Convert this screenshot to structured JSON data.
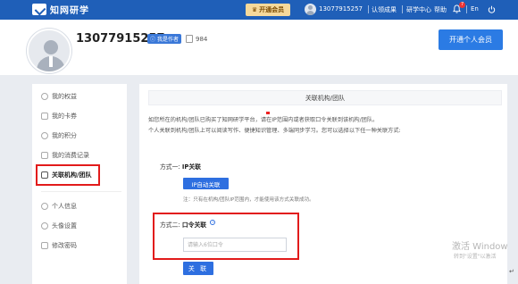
{
  "topbar": {
    "brand": "知网研学",
    "vip_label": "开通会员",
    "phone": "13077915257",
    "links": [
      "认领成果",
      "研学中心",
      "帮助"
    ],
    "notification_count": "7",
    "language": "En"
  },
  "profile": {
    "name": "13077915257",
    "author_tag": "我是作者",
    "count": "984",
    "open_button": "开通个人会员"
  },
  "sidebar": {
    "items": [
      {
        "label": "我的权益",
        "icon": "shield-icon"
      },
      {
        "label": "我的卡券",
        "icon": "card-icon"
      },
      {
        "label": "我的积分",
        "icon": "points-icon"
      },
      {
        "label": "我的消费记录",
        "icon": "record-icon"
      },
      {
        "label": "关联机构/团队",
        "icon": "link-icon"
      },
      {
        "label": "个人信息",
        "icon": "user-icon"
      },
      {
        "label": "头像设置",
        "icon": "avatar-icon"
      },
      {
        "label": "修改密码",
        "icon": "lock-icon"
      }
    ]
  },
  "main": {
    "title": "关联机构/团队",
    "desc_line1": "如您所在的机构/团队已购买了知网研学平台，请在IP范围内或者获取口令关联到该机构/团队。",
    "desc_line2": "个人关联到机构/团队上可以阅读写作、便捷知识管理、多端同步学习。您可以选择以下任一种关联方式:",
    "method1_prefix": "方式一:",
    "method1_name": "IP关联",
    "ip_button": "IP自动关联",
    "note": "注：只有在机构/团队IP范围内，才能使用该方式关联成功。",
    "method2_prefix": "方式二:",
    "method2_name": "口令关联",
    "code_placeholder": "请输入6位口令",
    "link_button": "关 联"
  },
  "watermark": {
    "line1": "激活 Window",
    "line2": "转到\"设置\"以激活"
  },
  "colors": {
    "primary": "#2e6fe0",
    "topbar": "#1f5fb8",
    "highlight": "#e21b1b",
    "vip": "#f6d99b"
  }
}
